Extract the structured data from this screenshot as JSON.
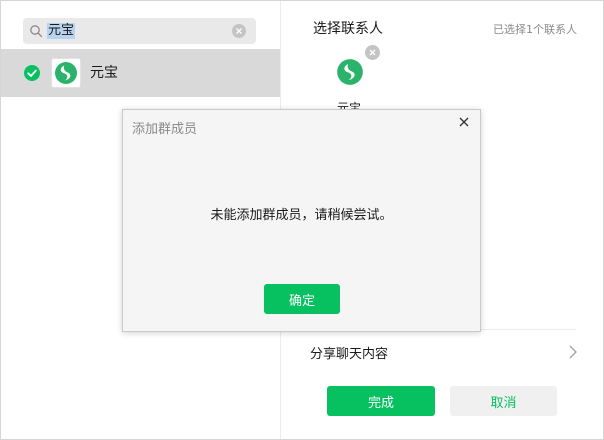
{
  "colors": {
    "accent": "#07c160",
    "selected_row": "#d9d9d9",
    "dialog_bg": "#f5f5f5"
  },
  "left": {
    "search": {
      "value": "元宝",
      "icon": "search-icon",
      "clear_icon": "clear-icon"
    },
    "contacts": [
      {
        "name": "元宝",
        "checked": true,
        "avatar_icon": "yuanbao-logo-icon"
      }
    ]
  },
  "right": {
    "title": "选择联系人",
    "selected_count": "已选择1个联系人",
    "selected": [
      {
        "name": "元宝",
        "avatar_icon": "yuanbao-logo-icon",
        "remove_icon": "remove-icon"
      }
    ],
    "share_label": "分享聊天内容",
    "done_label": "完成",
    "cancel_label": "取消"
  },
  "dialog": {
    "title": "添加群成员",
    "message": "未能添加群成员，请稍候尝试。",
    "confirm_label": "确定",
    "close_icon": "close-icon"
  }
}
